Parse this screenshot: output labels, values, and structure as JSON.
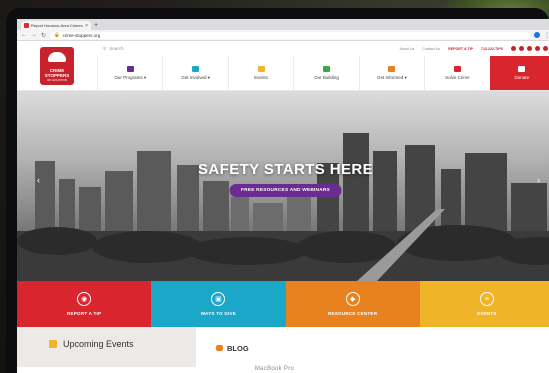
{
  "browser": {
    "tab_title": "Report Houston-Area Crimes",
    "url": "crime-stoppers.org",
    "search_placeholder": "Search"
  },
  "logo": {
    "line1": "CRIME",
    "line2": "STOPPERS",
    "sub": "OF HOUSTON"
  },
  "utility": {
    "links": [
      "About Us",
      "Contact Us"
    ],
    "tip": "REPORT A TIP",
    "phone": "713.222.TIPS"
  },
  "menu": [
    {
      "label": "Our Programs ▾",
      "icon_color": "#6b2c91"
    },
    {
      "label": "Get Involved ▾",
      "icon_color": "#1aa7c8"
    },
    {
      "label": "Events",
      "icon_color": "#f0b429"
    },
    {
      "label": "Our Building",
      "icon_color": "#3aa845"
    },
    {
      "label": "Get Informed ▾",
      "icon_color": "#e8821e"
    },
    {
      "label": "Solve Crime",
      "icon_color": "#d9252e"
    },
    {
      "label": "Donate",
      "icon_color": "#ffffff"
    }
  ],
  "hero": {
    "title": "SAFETY STARTS HERE",
    "button": "FREE RESOURCES AND WEBINARS"
  },
  "tiles": [
    {
      "label": "REPORT A TIP",
      "color": "#d9252e",
      "icon": "megaphone-icon"
    },
    {
      "label": "WAYS TO GIVE",
      "color": "#1aa7c8",
      "icon": "gift-icon"
    },
    {
      "label": "RESOURCE CENTER",
      "color": "#e8821e",
      "icon": "shield-icon"
    },
    {
      "label": "EVENTS",
      "color": "#f0b429",
      "icon": "list-icon"
    }
  ],
  "sections": {
    "events_title": "Upcoming Events",
    "blog_title": "BLOG"
  },
  "device_caption": "MacBook Pro"
}
